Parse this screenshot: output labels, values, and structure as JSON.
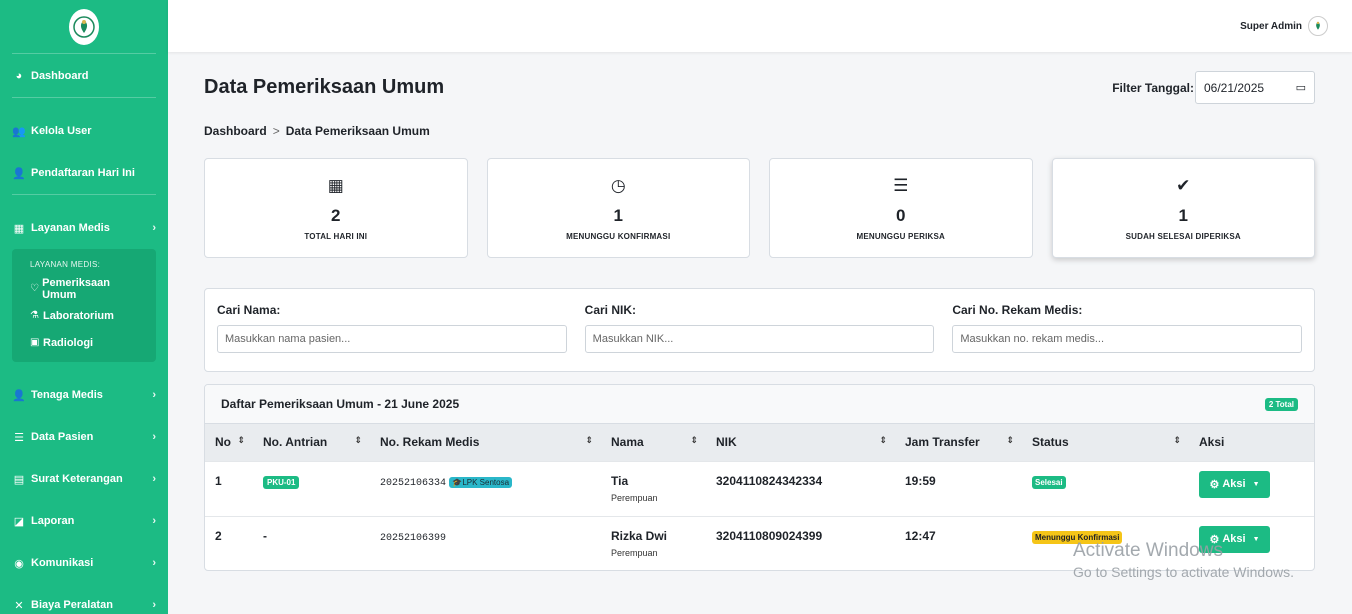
{
  "sidebar": {
    "items": [
      {
        "label": "Dashboard",
        "icon": "dashboard-icon",
        "glyph": "◕"
      },
      {
        "label": "Kelola User",
        "icon": "users-icon",
        "glyph": "👥"
      },
      {
        "label": "Pendaftaran Hari Ini",
        "icon": "user-plus-icon",
        "glyph": "👤"
      },
      {
        "label": "Layanan Medis",
        "icon": "hospital-icon",
        "glyph": "▦"
      },
      {
        "label": "Tenaga Medis",
        "icon": "user-icon",
        "glyph": "👤"
      },
      {
        "label": "Data Pasien",
        "icon": "database-icon",
        "glyph": "☰"
      },
      {
        "label": "Surat Keterangan",
        "icon": "file-icon",
        "glyph": "▤"
      },
      {
        "label": "Laporan",
        "icon": "chart-icon",
        "glyph": "◪"
      },
      {
        "label": "Komunikasi",
        "icon": "comments-icon",
        "glyph": "◉"
      },
      {
        "label": "Biaya Peralatan",
        "icon": "tools-icon",
        "glyph": "✕"
      }
    ],
    "submenu": {
      "heading": "LAYANAN MEDIS:",
      "items": [
        {
          "label": "Pemeriksaan Umum",
          "icon": "stethoscope-icon",
          "glyph": "♡"
        },
        {
          "label": "Laboratorium",
          "icon": "flask-icon",
          "glyph": "⚗"
        },
        {
          "label": "Radiologi",
          "icon": "xray-icon",
          "glyph": "▣"
        }
      ]
    }
  },
  "topbar": {
    "user_name": "Super Admin"
  },
  "page": {
    "title": "Data Pemeriksaan Umum",
    "filter_label": "Filter Tanggal:",
    "filter_date": "06/21/2025",
    "breadcrumb": [
      "Dashboard",
      "Data Pemeriksaan Umum"
    ],
    "breadcrumb_sep": ">"
  },
  "stats": [
    {
      "value": "2",
      "label": "TOTAL HARI INI",
      "icon": "calendar-icon",
      "glyph": "▦"
    },
    {
      "value": "1",
      "label": "MENUNGGU KONFIRMASI",
      "icon": "clock-icon",
      "glyph": "◷"
    },
    {
      "value": "0",
      "label": "MENUNGGU PERIKSA",
      "icon": "list-icon",
      "glyph": "☰"
    },
    {
      "value": "1",
      "label": "SUDAH SELESAI DIPERIKSA",
      "icon": "check-circle-icon",
      "glyph": "✔"
    }
  ],
  "search": {
    "nama_label": "Cari Nama:",
    "nama_placeholder": "Masukkan nama pasien...",
    "nik_label": "Cari NIK:",
    "nik_placeholder": "Masukkan NIK...",
    "rm_label": "Cari No. Rekam Medis:",
    "rm_placeholder": "Masukkan no. rekam medis..."
  },
  "table": {
    "title": "Daftar Pemeriksaan Umum - 21 June 2025",
    "total_badge": "2 Total",
    "columns": [
      "No",
      "No. Antrian",
      "No. Rekam Medis",
      "Nama",
      "NIK",
      "Jam Transfer",
      "Status",
      "Aksi"
    ],
    "rows": [
      {
        "no": "1",
        "antrian": "PKU-01",
        "rekam_medis": "20252106334",
        "lpk": "LPK Sentosa",
        "nama": "Tia",
        "gender": "Perempuan",
        "nik": "3204110824342334",
        "jam": "19:59",
        "status": "Selesai",
        "status_type": "selesai",
        "aksi": "Aksi"
      },
      {
        "no": "2",
        "antrian": "-",
        "rekam_medis": "20252106399",
        "lpk": "",
        "nama": "Rizka Dwi",
        "gender": "Perempuan",
        "nik": "3204110809024399",
        "jam": "12:47",
        "status": "Menunggu Konfirmasi",
        "status_type": "tunggu",
        "aksi": "Aksi"
      }
    ]
  },
  "watermark": {
    "line1": "Activate Windows",
    "line2": "Go to Settings to activate Windows."
  },
  "colors": {
    "primary": "#1cbb84",
    "warning": "#f5c518",
    "info": "#2ab7c9"
  }
}
